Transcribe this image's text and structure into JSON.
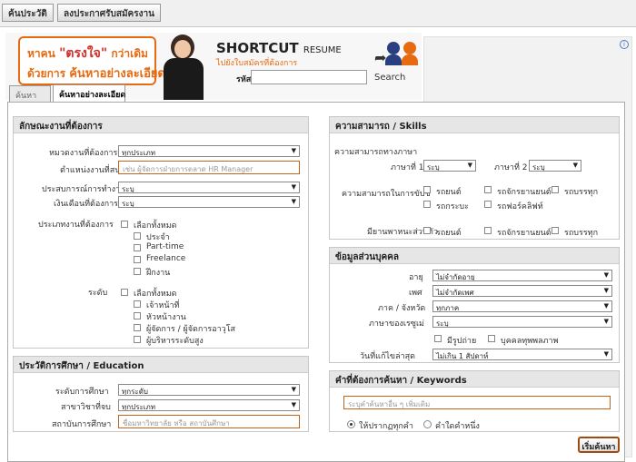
{
  "topnav": {
    "search_label": "ค้นประวัติ",
    "register_label": "ลงประกาศรับสมัครงาน"
  },
  "banner": {
    "promo_line1_a": "หาคน",
    "promo_line1_hl": "\"ตรงใจ\"",
    "promo_line1_b": "กว่าเดิม",
    "promo_line2_a": "ด้วยการ",
    "promo_line2_b": "ค้นหาอย่างละเอียด",
    "shortcut_title": "SHORTCUT",
    "shortcut_title_small": "RESUME",
    "shortcut_sub": "ไปยังใบสมัครที่ต้องการ",
    "code_label": "รหัส",
    "code_value": "",
    "search_link": "Search"
  },
  "ad": {
    "info_icon": "i"
  },
  "tabs": {
    "basic": "ค้นหา",
    "advanced": "ค้นหาอย่างละเอียด"
  },
  "job": {
    "header": "ลักษณะงานที่ต้องการ",
    "category_label": "หมวดงานที่ต้องการสมัคร",
    "category_value": "ทุกประเภท",
    "position_label": "ตำแหน่งงานที่สนใจ",
    "position_placeholder": "เช่น ผู้จัดการฝ่ายการตลาด HR Manager",
    "experience_label": "ประสบการณ์การทำงาน",
    "experience_value": "ระบุ",
    "salary_label": "เงินเดือนที่ต้องการ",
    "salary_value": "ระบุ",
    "jobtype_label": "ประเภทงานที่ต้องการ",
    "jobtypes": [
      "เลือกทั้งหมด",
      "ประจำ",
      "Part-time",
      "Freelance",
      "ฝึกงาน"
    ],
    "level_label": "ระดับ",
    "levels": [
      "เลือกทั้งหมด",
      "เจ้าหน้าที่",
      "หัวหน้างาน",
      "ผู้จัดการ / ผู้จัดการอาวุโส",
      "ผู้บริหารระดับสูง"
    ]
  },
  "education": {
    "header": "ประวัติการศึกษา / Education",
    "level_label": "ระดับการศึกษา",
    "level_value": "ทุกระดับ",
    "major_label": "สาขาวิชาที่จบ",
    "major_value": "ทุกประเภท",
    "institute_label": "สถาบันการศึกษา",
    "institute_placeholder": "ชื่อมหาวิทยาลัย หรือ สถาบันศึกษา"
  },
  "skills": {
    "header": "ความสามารถ / Skills",
    "lang_header": "ความสามารถทางภาษา",
    "lang1_label": "ภาษาที่ 1",
    "lang1_value": "ระบุ",
    "lang2_label": "ภาษาที่ 2",
    "lang2_value": "ระบุ",
    "drive_label": "ความสามารถในการขับขี่",
    "drive_options": [
      "รถยนต์",
      "รถจักรยานยนต์",
      "รถบรรทุก",
      "รถกระบะ",
      "รถฟอร์คลิฟท์"
    ],
    "vehicle_label": "มียานพาหนะส่วนตัว",
    "vehicle_options": [
      "รถยนต์",
      "รถจักรยานยนต์",
      "รถบรรทุก"
    ]
  },
  "personal": {
    "header": "ข้อมูลส่วนบุคคล",
    "age_label": "อายุ",
    "age_value": "ไม่จำกัดอายุ",
    "gender_label": "เพศ",
    "gender_value": "ไม่จำกัดเพศ",
    "region_label": "ภาค / จังหวัด",
    "region_value": "ทุกภาค",
    "nationality_label": "ภาษาของเรซูเม่",
    "nationality_value": "ระบุ",
    "photo_label": "มีรูปถ่าย",
    "disabled_label": "บุคคลทุพพลภาพ",
    "updated_label": "วันที่แก้ไขล่าสุด",
    "updated_value": "ไม่เกิน 1 สัปดาห์"
  },
  "keywords": {
    "header": "คำที่ต้องการค้นหา / Keywords",
    "placeholder": "ระบุคำค้นหาอื่น ๆ เพิ่มเติม",
    "option_all": "ให้ปรากฏทุกคำ",
    "option_any": "คำใดคำหนึ่ง"
  },
  "submit_label": "เริ่มค้นหา",
  "colors": {
    "accent": "#e86a10",
    "field_border": "#c0641e",
    "section_header": "#e6e6e6"
  }
}
